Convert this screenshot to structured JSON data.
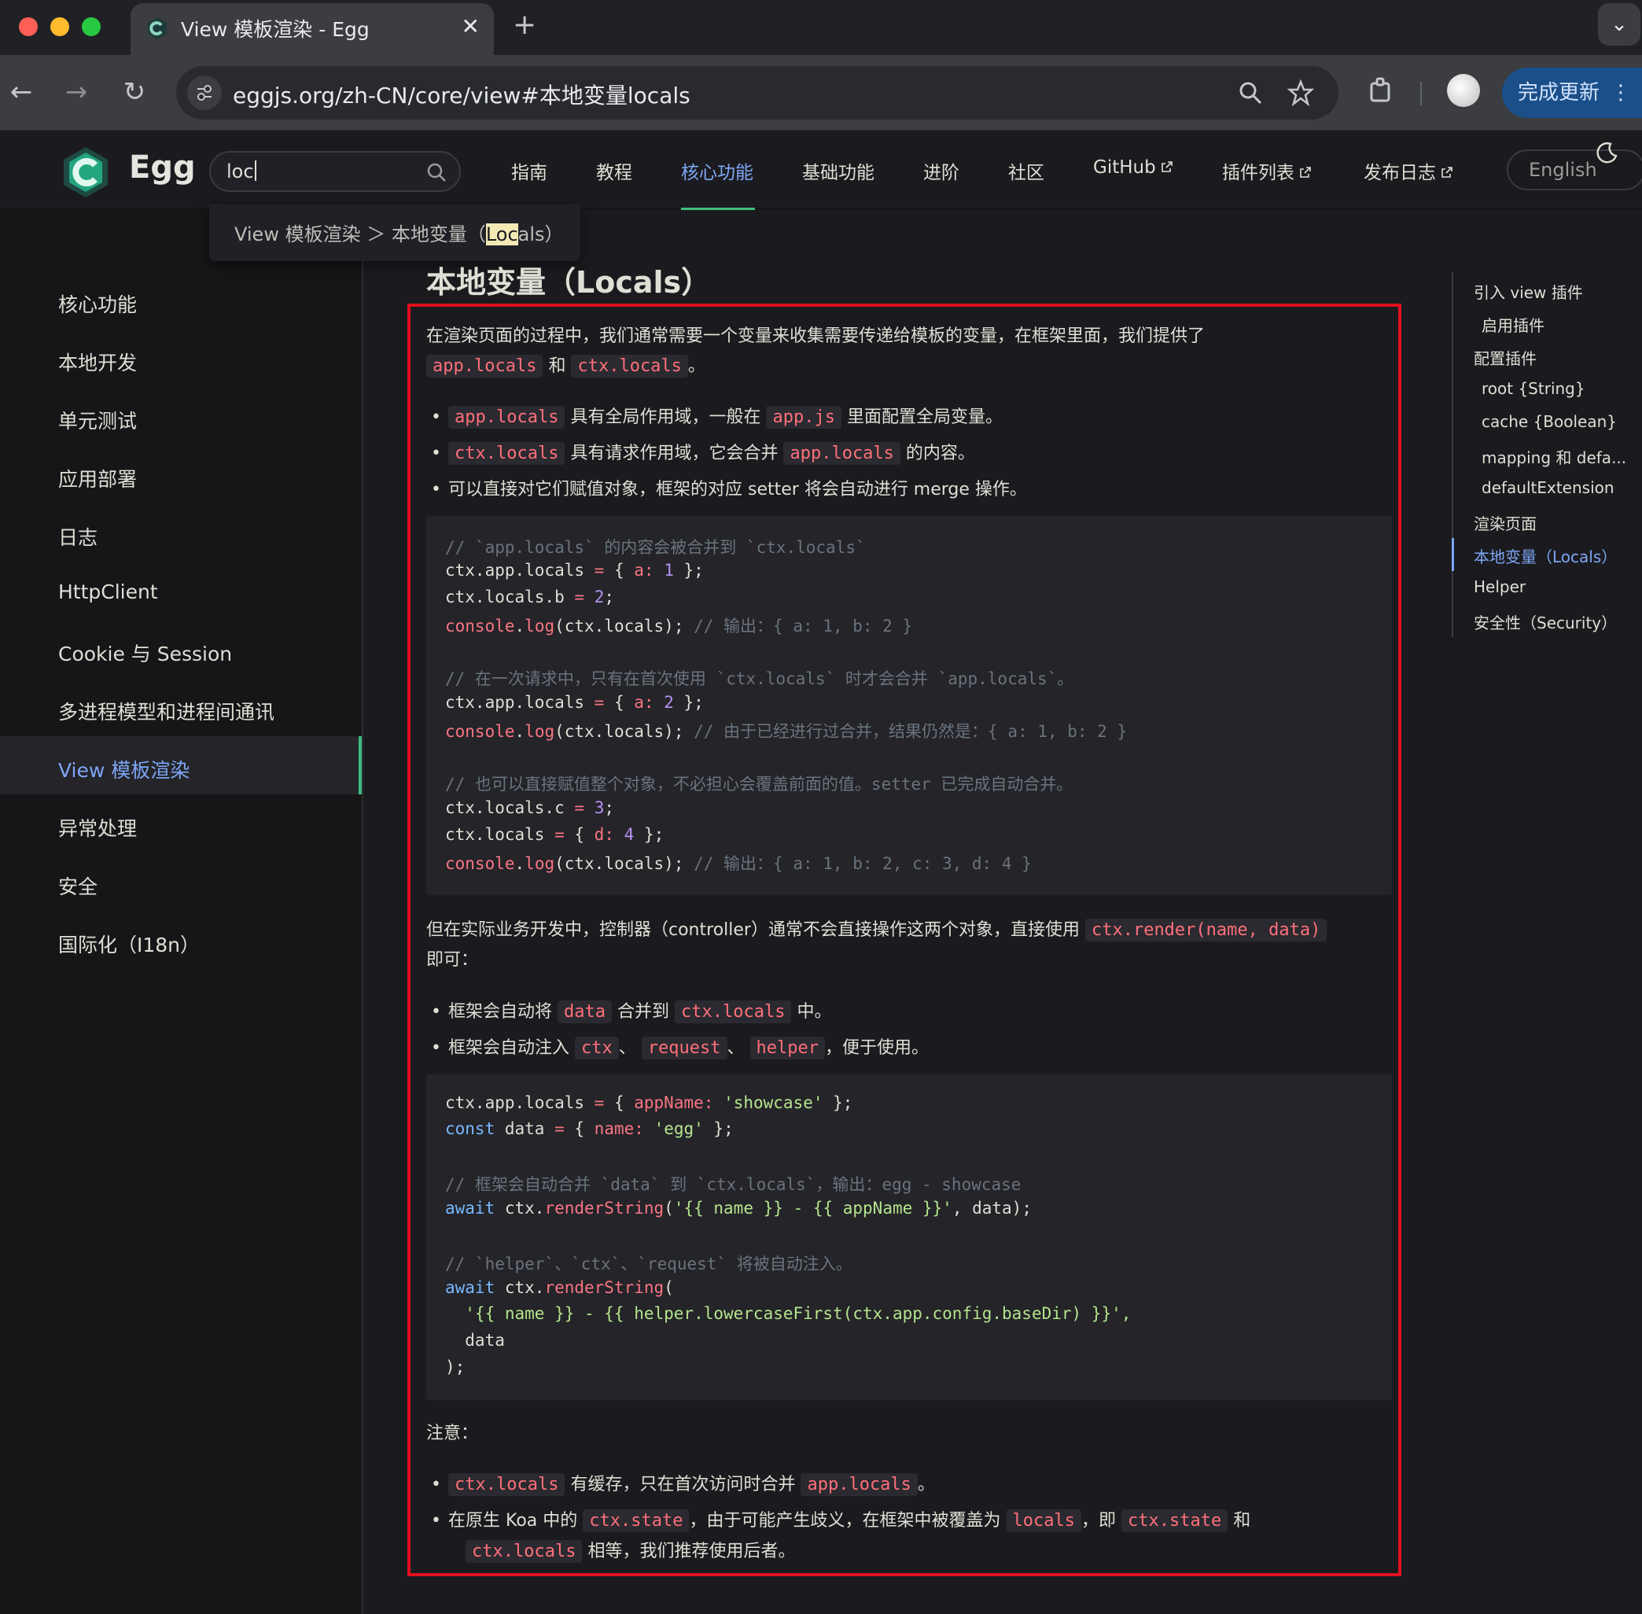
{
  "browser": {
    "tab_title": "View 模板渲染 - Egg",
    "url": "eggjs.org/zh-CN/core/view#本地变量locals",
    "update_label": "完成更新"
  },
  "site": {
    "logo_text": "Egg",
    "search_value": "loc",
    "nav": [
      "指南",
      "教程",
      "核心功能",
      "基础功能",
      "进阶",
      "社区",
      "GitHub",
      "插件列表",
      "发布日志"
    ],
    "active_nav": "核心功能",
    "language": "English"
  },
  "search_dropdown": {
    "prefix": "View 模板渲染 ＞ 本地变量（",
    "match": "Loc",
    "suffix": "als）"
  },
  "sidebar": {
    "items": [
      "核心功能",
      "本地开发",
      "单元测试",
      "应用部署",
      "日志",
      "HttpClient",
      "Cookie 与 Session",
      "多进程模型和进程间通讯",
      "View 模板渲染",
      "异常处理",
      "安全",
      "国际化（I18n）"
    ],
    "active": "View 模板渲染"
  },
  "content": {
    "title": "本地变量（Locals）",
    "intro_line1": "在渲染页面的过程中，我们通常需要一个变量来收集需要传递给模板的变量，在框架里面，我们提供了",
    "intro_code1": "app.locals",
    "intro_and": "和",
    "intro_code2": "ctx.locals",
    "intro_end": "。",
    "b1_code": "app.locals",
    "b1_text": "具有全局作用域，一般在",
    "b1_code2": "app.js",
    "b1_text2": "里面配置全局变量。",
    "b2_code": "ctx.locals",
    "b2_text": "具有请求作用域，它会合并",
    "b2_code2": "app.locals",
    "b2_text2": "的内容。",
    "b3_text": "可以直接对它们赋值对象，框架的对应 setter 将会自动进行 merge 操作。",
    "code1": [
      "// `app.locals` 的内容会被合并到 `ctx.locals`",
      "ctx.app.locals = { a: 1 };",
      "ctx.locals.b = 2;",
      "console.log(ctx.locals); // 输出：{ a: 1, b: 2 }",
      "",
      "// 在一次请求中，只有在首次使用 `ctx.locals` 时才会合并 `app.locals`。",
      "ctx.app.locals = { a: 2 };",
      "console.log(ctx.locals); // 由于已经进行过合并，结果仍然是：{ a: 1, b: 2 }",
      "",
      "// 也可以直接赋值整个对象，不必担心会覆盖前面的值。setter 已完成自动合并。",
      "ctx.locals.c = 3;",
      "ctx.locals = { d: 4 };",
      "console.log(ctx.locals); // 输出：{ a: 1, b: 2, c: 3, d: 4 }"
    ],
    "p2_text": "但在实际业务开发中，控制器（controller）通常不会直接操作这两个对象，直接使用",
    "p2_code": "ctx.render(name, data)",
    "p2_text2": "即可：",
    "b4_text": "框架会自动将",
    "b4_code": "data",
    "b4_text2": "合并到",
    "b4_code2": "ctx.locals",
    "b4_text3": "中。",
    "b5_text": "框架会自动注入",
    "b5_code1": "ctx",
    "b5_sep1": "、",
    "b5_code2": "request",
    "b5_sep2": "、",
    "b5_code3": "helper",
    "b5_text2": "，便于使用。",
    "code2": [
      "ctx.app.locals = { appName: 'showcase' };",
      "const data = { name: 'egg' };",
      "",
      "// 框架会自动合并 `data` 到 `ctx.locals`，输出：egg - showcase",
      "await ctx.renderString('{{ name }} - {{ appName }}', data);",
      "",
      "// `helper`、`ctx`、`request` 将被自动注入。",
      "await ctx.renderString(",
      "  '{{ name }} - {{ helper.lowercaseFirst(ctx.app.config.baseDir) }}',",
      "  data",
      ");"
    ],
    "note_label": "注意：",
    "n1_code": "ctx.locals",
    "n1_text": "有缓存，只在首次访问时合并",
    "n1_code2": "app.locals",
    "n1_end": "。",
    "n2_text": "在原生 Koa 中的",
    "n2_code": "ctx.state",
    "n2_text2": "，由于可能产生歧义，在框架中被覆盖为",
    "n2_code2": "locals",
    "n2_text3": "，即",
    "n2_code3": "ctx.state",
    "n2_text4": "和",
    "n2_code4": "ctx.locals",
    "n2_text5": "相等，我们推荐使用后者。"
  },
  "outline": {
    "items": [
      "引入 view 插件",
      "启用插件",
      "配置插件",
      "root {String}",
      "cache {Boolean}",
      "mapping 和 defa...",
      "defaultExtension",
      "渲染页面",
      "本地变量（Locals）",
      "Helper",
      "安全性（Security）"
    ],
    "active": "本地变量（Locals）"
  },
  "colors": {
    "accent": "#7ea6f5",
    "brand_green": "#3dbd7d",
    "highlight_box": "#e0101e"
  }
}
